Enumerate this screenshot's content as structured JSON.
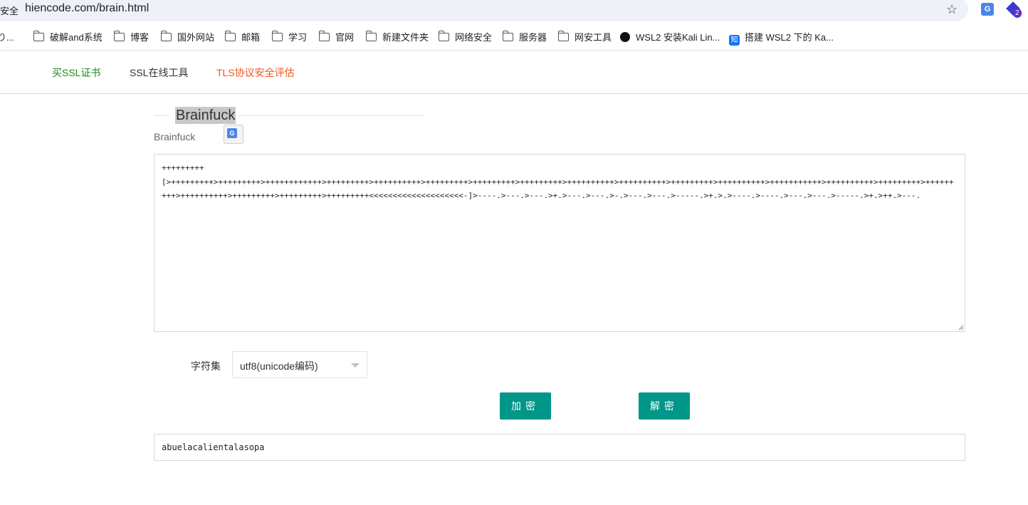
{
  "browser": {
    "security_label": "安全",
    "url": "hiencode.com/brain.html",
    "bookmarks": [
      {
        "label": "り...",
        "icon": "partial"
      },
      {
        "label": "破解and系统",
        "icon": "folder-icon"
      },
      {
        "label": "博客",
        "icon": "folder-icon"
      },
      {
        "label": "国外网站",
        "icon": "folder-icon"
      },
      {
        "label": "邮箱",
        "icon": "folder-icon"
      },
      {
        "label": "学习",
        "icon": "folder-icon"
      },
      {
        "label": "官网",
        "icon": "folder-icon"
      },
      {
        "label": "新建文件夹",
        "icon": "folder-icon"
      },
      {
        "label": "网络安全",
        "icon": "folder-icon"
      },
      {
        "label": "服务器",
        "icon": "folder-icon"
      },
      {
        "label": "网安工具",
        "icon": "folder-icon"
      },
      {
        "label": "WSL2 安装Kali Lin...",
        "icon": "kali-icon"
      },
      {
        "label": "搭建 WSL2 下的 Ka...",
        "icon": "zhihu-icon",
        "icon_text": "知"
      }
    ],
    "extension_badge": "2"
  },
  "nav": {
    "items": [
      {
        "label": "买SSL证书",
        "color": "#1a8a1a"
      },
      {
        "label": "SSL在线工具",
        "color": "#333333"
      },
      {
        "label": "TLS协议安全评估",
        "color": "#ee5522"
      }
    ]
  },
  "tool": {
    "title": "Brainfuck",
    "subtitle": "Brainfuck",
    "input_code": "+++++++++\n[>+++++++++>+++++++++>++++++++++++>+++++++++>++++++++++>+++++++++>+++++++++>+++++++++>++++++++++>++++++++++>+++++++++>++++++++++>+++++++++++>++++++++++>+++++++++>+++++++++>++++++++++>+++++++++>+++++++++>+++++++++<<<<<<<<<<<<<<<<<<<<-]>----.>---.>---.>+.>---.>---.>-.>---.>---.>-----.>+.>.>----.>----.>---.>---.>-----.>+.>++.>---.",
    "charset_label": "字符集",
    "charset_value": "utf8(unicode编码)",
    "encrypt_label": "加密",
    "decrypt_label": "解密",
    "output_text": "abuelacalientalasopa"
  },
  "colors": {
    "accent": "#009688"
  }
}
